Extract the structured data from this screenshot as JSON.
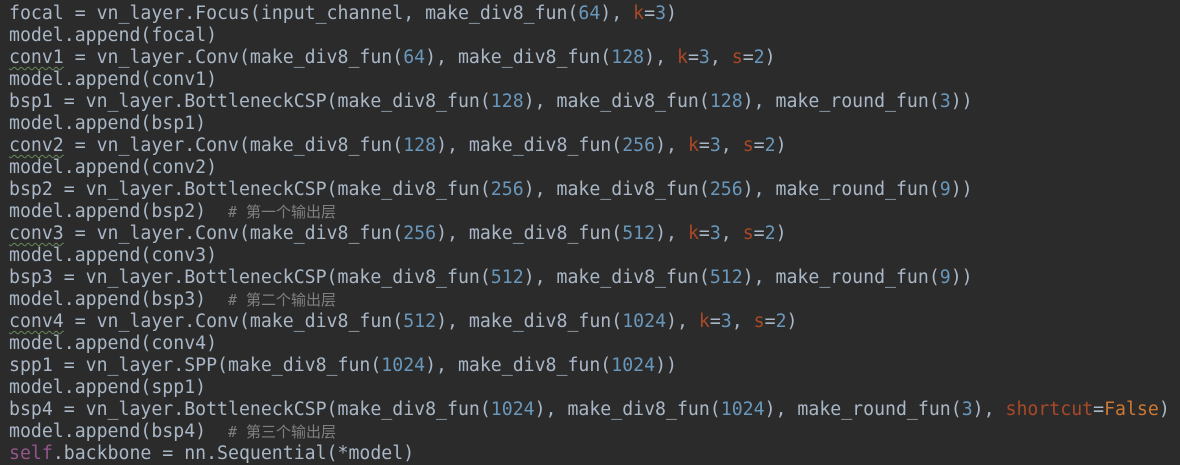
{
  "editor": {
    "lines": [
      [
        {
          "t": "focal = vn_layer.Focus(input_channel, make_div8_fun("
        },
        {
          "t": "64",
          "c": "num"
        },
        {
          "t": "), "
        },
        {
          "t": "k",
          "c": "param"
        },
        {
          "t": "="
        },
        {
          "t": "3",
          "c": "num"
        },
        {
          "t": ")"
        }
      ],
      [
        {
          "t": "model.append(focal)"
        }
      ],
      [
        {
          "t": "conv1",
          "c": "warn"
        },
        {
          "t": " = vn_layer.Conv(make_div8_fun("
        },
        {
          "t": "64",
          "c": "num"
        },
        {
          "t": "), make_div8_fun("
        },
        {
          "t": "128",
          "c": "num"
        },
        {
          "t": "), "
        },
        {
          "t": "k",
          "c": "param"
        },
        {
          "t": "="
        },
        {
          "t": "3",
          "c": "num"
        },
        {
          "t": ", "
        },
        {
          "t": "s",
          "c": "param"
        },
        {
          "t": "="
        },
        {
          "t": "2",
          "c": "num"
        },
        {
          "t": ")"
        }
      ],
      [
        {
          "t": "model.append(conv1)"
        }
      ],
      [
        {
          "t": "bsp1 = vn_layer.BottleneckCSP(make_div8_fun("
        },
        {
          "t": "128",
          "c": "num"
        },
        {
          "t": "), make_div8_fun("
        },
        {
          "t": "128",
          "c": "num"
        },
        {
          "t": "), make_round_fun("
        },
        {
          "t": "3",
          "c": "num"
        },
        {
          "t": "))"
        }
      ],
      [
        {
          "t": "model.append(bsp1)"
        }
      ],
      [
        {
          "t": "conv2",
          "c": "warn"
        },
        {
          "t": " = vn_layer.Conv(make_div8_fun("
        },
        {
          "t": "128",
          "c": "num"
        },
        {
          "t": "), make_div8_fun("
        },
        {
          "t": "256",
          "c": "num"
        },
        {
          "t": "), "
        },
        {
          "t": "k",
          "c": "param"
        },
        {
          "t": "="
        },
        {
          "t": "3",
          "c": "num"
        },
        {
          "t": ", "
        },
        {
          "t": "s",
          "c": "param"
        },
        {
          "t": "="
        },
        {
          "t": "2",
          "c": "num"
        },
        {
          "t": ")"
        }
      ],
      [
        {
          "t": "model.append(conv2)"
        }
      ],
      [
        {
          "t": "bsp2 = vn_layer.BottleneckCSP(make_div8_fun("
        },
        {
          "t": "256",
          "c": "num"
        },
        {
          "t": "), make_div8_fun("
        },
        {
          "t": "256",
          "c": "num"
        },
        {
          "t": "), make_round_fun("
        },
        {
          "t": "9",
          "c": "num"
        },
        {
          "t": "))"
        }
      ],
      [
        {
          "t": "model.append(bsp2)  "
        },
        {
          "t": "# 第一个输出层",
          "c": "comment"
        }
      ],
      [
        {
          "t": "conv3",
          "c": "warn"
        },
        {
          "t": " = vn_layer.Conv(make_div8_fun("
        },
        {
          "t": "256",
          "c": "num"
        },
        {
          "t": "), make_div8_fun("
        },
        {
          "t": "512",
          "c": "num"
        },
        {
          "t": "), "
        },
        {
          "t": "k",
          "c": "param"
        },
        {
          "t": "="
        },
        {
          "t": "3",
          "c": "num"
        },
        {
          "t": ", "
        },
        {
          "t": "s",
          "c": "param"
        },
        {
          "t": "="
        },
        {
          "t": "2",
          "c": "num"
        },
        {
          "t": ")"
        }
      ],
      [
        {
          "t": "model.append(conv3)"
        }
      ],
      [
        {
          "t": "bsp3 = vn_layer.BottleneckCSP(make_div8_fun("
        },
        {
          "t": "512",
          "c": "num"
        },
        {
          "t": "), make_div8_fun("
        },
        {
          "t": "512",
          "c": "num"
        },
        {
          "t": "), make_round_fun("
        },
        {
          "t": "9",
          "c": "num"
        },
        {
          "t": "))"
        }
      ],
      [
        {
          "t": "model.append(bsp3)  "
        },
        {
          "t": "# 第二个输出层",
          "c": "comment"
        }
      ],
      [
        {
          "t": "conv4",
          "c": "warn"
        },
        {
          "t": " = vn_layer.Conv(make_div8_fun("
        },
        {
          "t": "512",
          "c": "num"
        },
        {
          "t": "), make_div8_fun("
        },
        {
          "t": "1024",
          "c": "num"
        },
        {
          "t": "), "
        },
        {
          "t": "k",
          "c": "param"
        },
        {
          "t": "="
        },
        {
          "t": "3",
          "c": "num"
        },
        {
          "t": ", "
        },
        {
          "t": "s",
          "c": "param"
        },
        {
          "t": "="
        },
        {
          "t": "2",
          "c": "num"
        },
        {
          "t": ")"
        }
      ],
      [
        {
          "t": "model.append(conv4)"
        }
      ],
      [
        {
          "t": "spp1 = vn_layer.SPP(make_div8_fun("
        },
        {
          "t": "1024",
          "c": "num"
        },
        {
          "t": "), make_div8_fun("
        },
        {
          "t": "1024",
          "c": "num"
        },
        {
          "t": "))"
        }
      ],
      [
        {
          "t": "model.append(spp1)"
        }
      ],
      [
        {
          "t": "bsp4 = vn_layer.BottleneckCSP(make_div8_fun("
        },
        {
          "t": "1024",
          "c": "num"
        },
        {
          "t": "), make_div8_fun("
        },
        {
          "t": "1024",
          "c": "num"
        },
        {
          "t": "), make_round_fun("
        },
        {
          "t": "3",
          "c": "num"
        },
        {
          "t": "), "
        },
        {
          "t": "shortcut",
          "c": "param"
        },
        {
          "t": "="
        },
        {
          "t": "False",
          "c": "kw"
        },
        {
          "t": ")"
        }
      ],
      [
        {
          "t": "model.append(bsp4)  "
        },
        {
          "t": "# 第三个输出层",
          "c": "comment"
        }
      ],
      [
        {
          "t": "self",
          "c": "self"
        },
        {
          "t": ".backbone = nn.Sequential(*model)"
        }
      ]
    ]
  },
  "colors": {
    "background": "#2b2b2b",
    "default_text": "#a9b7c6",
    "number": "#6897bb",
    "keyword": "#cc7832",
    "parameter": "#aa4926",
    "self": "#94558d",
    "comment": "#808080"
  }
}
